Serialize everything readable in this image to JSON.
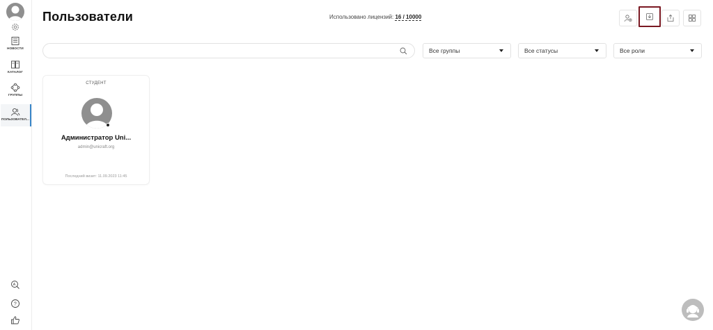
{
  "sidebar": {
    "items": [
      {
        "label": "НОВОСТИ",
        "icon": "news-icon"
      },
      {
        "label": "КАТАЛОГ",
        "icon": "catalog-icon"
      },
      {
        "label": "ГРУППЫ",
        "icon": "groups-icon"
      },
      {
        "label": "ПОЛЬЗОВАТЕЛ...",
        "icon": "users-icon",
        "active": true
      }
    ],
    "bottom_icons": [
      "translate-icon",
      "help-icon",
      "thumbs-up-icon"
    ]
  },
  "header": {
    "title": "Пользователи",
    "licenses_label": "Использовано лицензий:",
    "licenses_count": "16 / 10000"
  },
  "toolbar": {
    "buttons": [
      "add-user-icon",
      "download-icon",
      "upload-icon",
      "grid-view-icon"
    ]
  },
  "filters": {
    "search_placeholder": "",
    "groups": "Все группы",
    "statuses": "Все статусы",
    "roles": "Все роли"
  },
  "users": [
    {
      "role": "СТУДЕНТ",
      "name": "Администратор Uni...",
      "email": "admin@unicraft.org",
      "last_visit": "Последний визит: 11.09.2023 11:45"
    }
  ],
  "colors": {
    "accent": "#3a86c8",
    "highlight_border": "#7a1822",
    "avatar": "#8f8f8f"
  }
}
